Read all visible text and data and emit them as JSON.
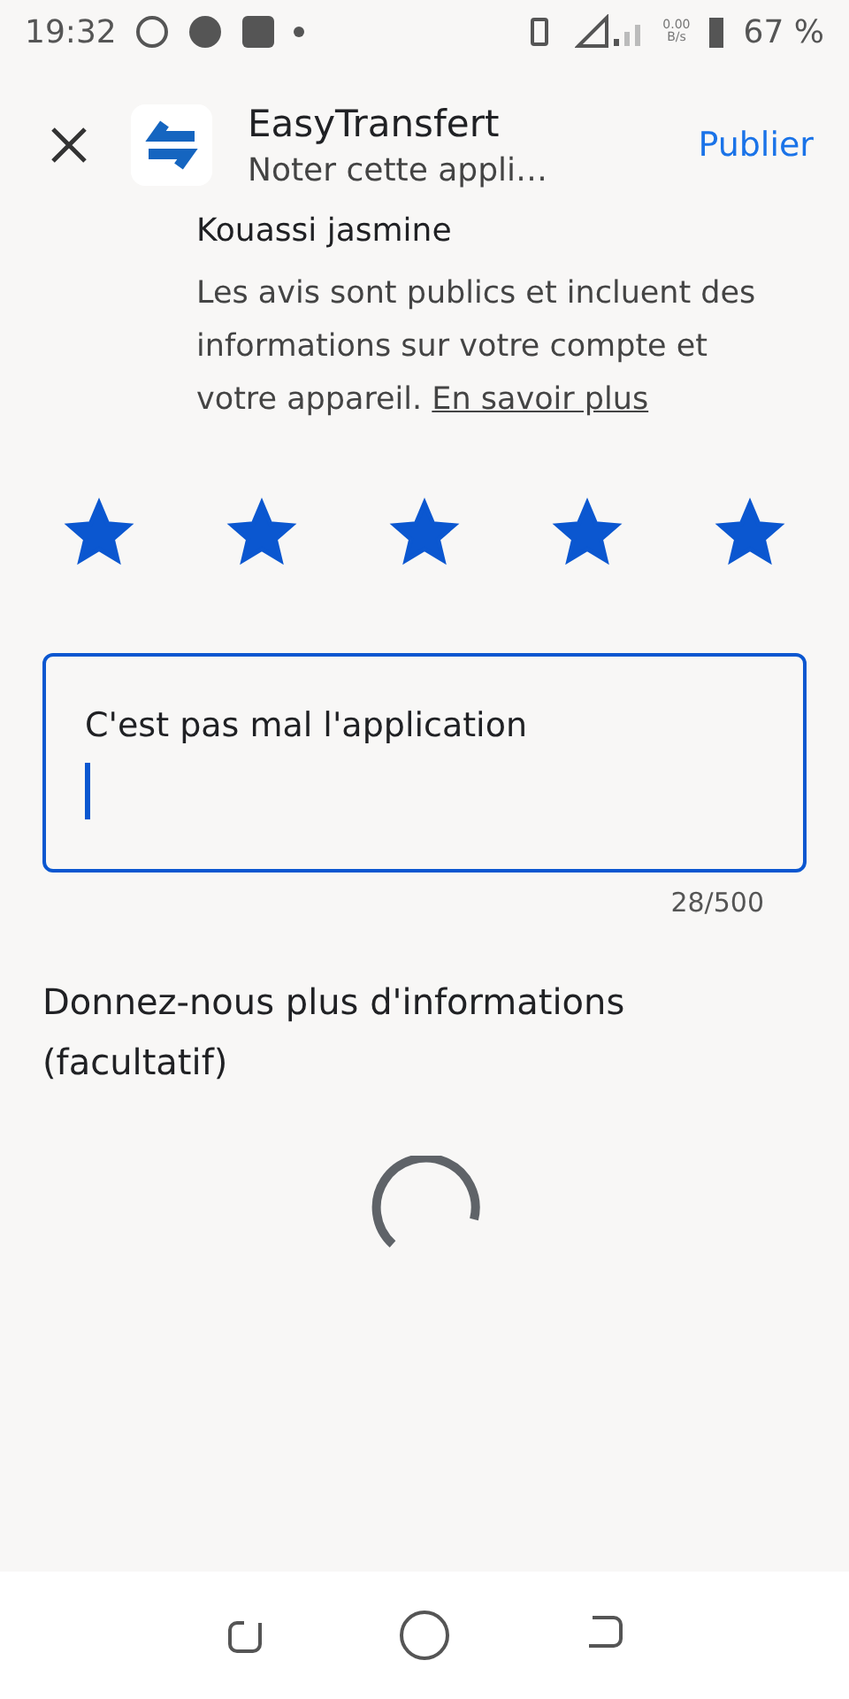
{
  "status_bar": {
    "time": "19:32",
    "net_speed_value": "0.00",
    "net_speed_unit": "B/s",
    "battery": "67 %"
  },
  "header": {
    "app_name": "EasyTransfert",
    "subtitle": "Noter cette appli…",
    "action": "Publier"
  },
  "reviewer": "Kouassi jasmine",
  "disclosure": {
    "text": "Les avis sont publics et incluent des informations sur votre compte et votre appareil.",
    "link": "En savoir plus"
  },
  "rating": {
    "stars": 5
  },
  "review": {
    "value": "C'est pas mal l'application",
    "counter": "28/500"
  },
  "more_info": {
    "title": "Donnez-nous plus d'informations (facultatif)",
    "loading": true
  }
}
